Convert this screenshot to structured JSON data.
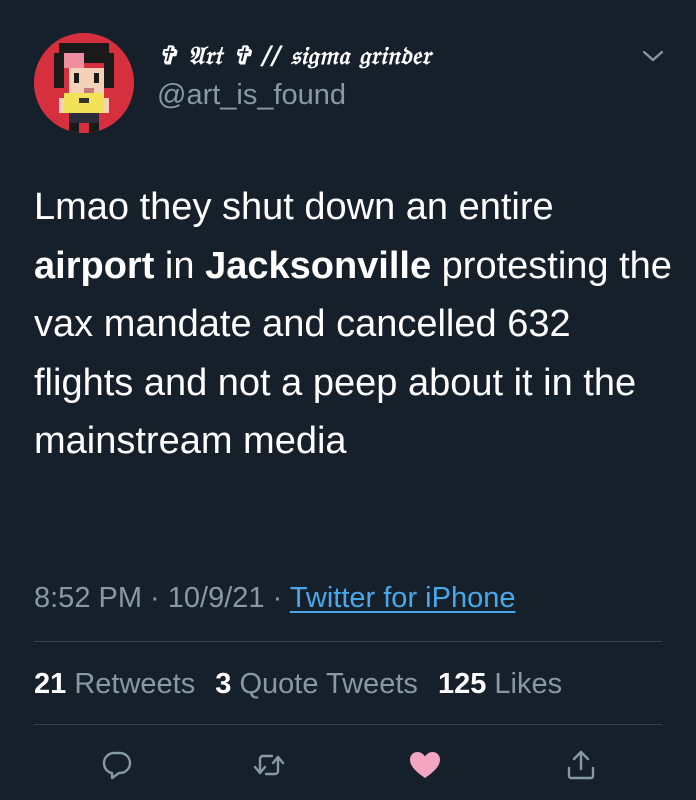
{
  "tweet": {
    "display_name": "✞ 𝔄𝔯𝔱 ✞ // 𝔰𝔦𝔤𝔪𝔞 𝔤𝔯𝔦𝔫𝔡𝔢𝔯",
    "handle": "@art_is_found",
    "text": {
      "part1": "Lmao they shut down an entire ",
      "bold1": "airport",
      "part2": " in ",
      "bold2": "Jacksonville",
      "part3": " protesting the vax mandate and cancelled 632 flights and not a peep about it in the mainstream media"
    },
    "time": "8:52 PM",
    "separator": " · ",
    "date": "10/9/21",
    "source": "Twitter for iPhone",
    "stats": {
      "retweets_count": "21",
      "retweets_label": "Retweets",
      "quotes_count": "3",
      "quotes_label": "Quote Tweets",
      "likes_count": "125",
      "likes_label": "Likes"
    }
  },
  "colors": {
    "background": "#15202b",
    "secondary_text": "#8899a6",
    "link": "#4ba8e8",
    "like_heart": "#f4a6c0",
    "divider": "#38444d"
  },
  "icons": {
    "menu": "chevron-down-icon",
    "reply": "reply-icon",
    "retweet": "retweet-icon",
    "like": "heart-icon",
    "share": "share-icon"
  }
}
